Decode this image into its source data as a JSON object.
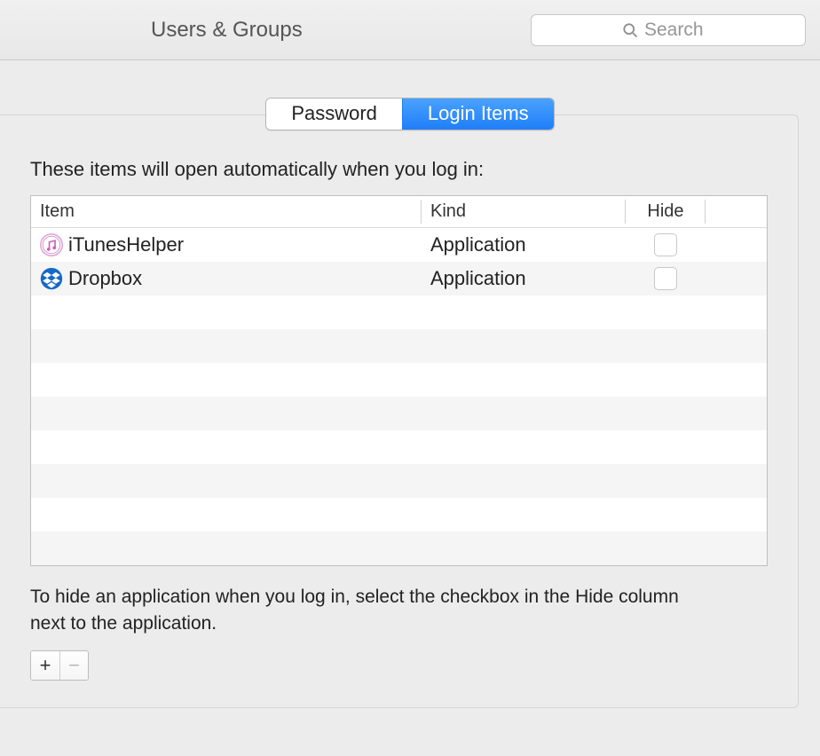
{
  "window": {
    "title": "Users & Groups"
  },
  "search": {
    "placeholder": "Search"
  },
  "tabs": {
    "password_label": "Password",
    "login_items_label": "Login Items"
  },
  "main": {
    "description": "These items will open automatically when you log in:",
    "columns": {
      "item": "Item",
      "kind": "Kind",
      "hide": "Hide"
    },
    "items": [
      {
        "name": "iTunesHelper",
        "kind": "Application",
        "icon": "itunes",
        "hide": false
      },
      {
        "name": "Dropbox",
        "kind": "Application",
        "icon": "dropbox",
        "hide": false
      }
    ],
    "hint": "To hide an application when you log in, select the checkbox in the Hide column next to the application.",
    "buttons": {
      "add": "+",
      "remove": "−"
    }
  }
}
